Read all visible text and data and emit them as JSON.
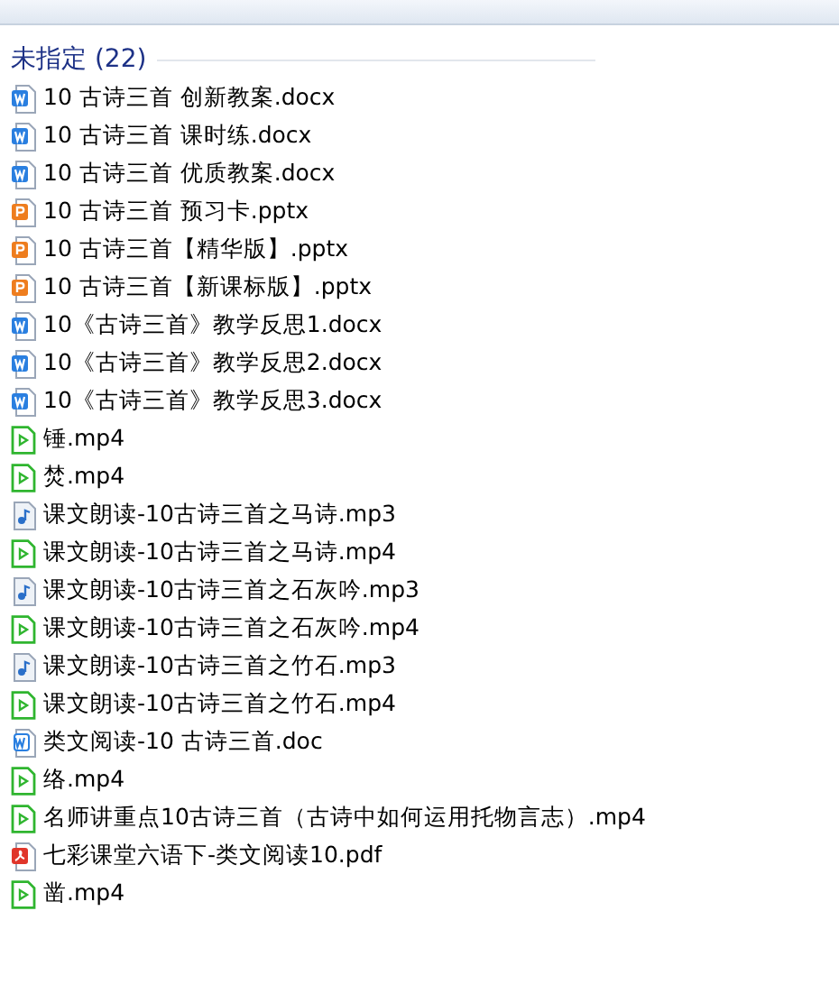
{
  "group": {
    "title": "未指定 (22)"
  },
  "files": [
    {
      "name": "10 古诗三首 创新教案.docx",
      "kind": "word"
    },
    {
      "name": "10 古诗三首 课时练.docx",
      "kind": "word"
    },
    {
      "name": "10 古诗三首 优质教案.docx",
      "kind": "word"
    },
    {
      "name": "10 古诗三首 预习卡.pptx",
      "kind": "ppt"
    },
    {
      "name": "10 古诗三首【精华版】.pptx",
      "kind": "ppt"
    },
    {
      "name": "10 古诗三首【新课标版】.pptx",
      "kind": "ppt"
    },
    {
      "name": "10《古诗三首》教学反思1.docx",
      "kind": "word"
    },
    {
      "name": "10《古诗三首》教学反思2.docx",
      "kind": "word"
    },
    {
      "name": "10《古诗三首》教学反思3.docx",
      "kind": "word"
    },
    {
      "name": "锤.mp4",
      "kind": "video"
    },
    {
      "name": "焚.mp4",
      "kind": "video"
    },
    {
      "name": "课文朗读-10古诗三首之马诗.mp3",
      "kind": "audio"
    },
    {
      "name": "课文朗读-10古诗三首之马诗.mp4",
      "kind": "video"
    },
    {
      "name": "课文朗读-10古诗三首之石灰吟.mp3",
      "kind": "audio"
    },
    {
      "name": "课文朗读-10古诗三首之石灰吟.mp4",
      "kind": "video"
    },
    {
      "name": "课文朗读-10古诗三首之竹石.mp3",
      "kind": "audio"
    },
    {
      "name": "课文朗读-10古诗三首之竹石.mp4",
      "kind": "video"
    },
    {
      "name": "类文阅读-10 古诗三首.doc",
      "kind": "doc"
    },
    {
      "name": "络.mp4",
      "kind": "video"
    },
    {
      "name": "名师讲重点10古诗三首（古诗中如何运用托物言志）.mp4",
      "kind": "video"
    },
    {
      "name": "七彩课堂六语下-类文阅读10.pdf",
      "kind": "pdf"
    },
    {
      "name": "凿.mp4",
      "kind": "video"
    }
  ]
}
